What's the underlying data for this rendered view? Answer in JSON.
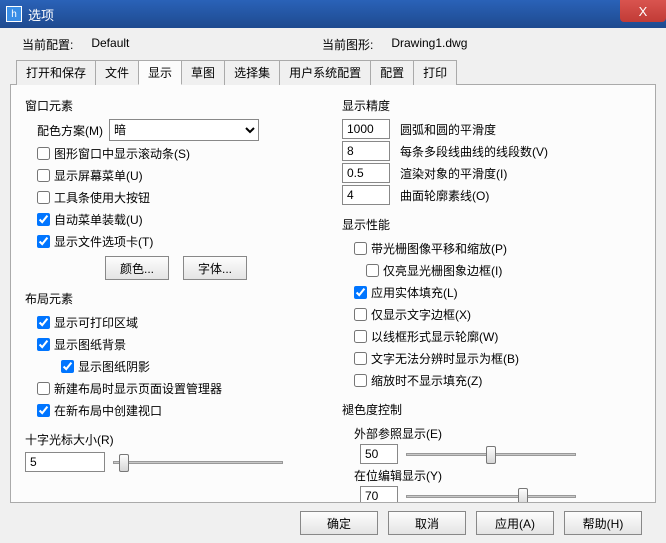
{
  "window": {
    "title": "选项",
    "close": "X"
  },
  "config": {
    "current_config_label": "当前配置:",
    "current_config_value": "Default",
    "current_drawing_label": "当前图形:",
    "current_drawing_value": "Drawing1.dwg"
  },
  "tabs": [
    "打开和保存",
    "文件",
    "显示",
    "草图",
    "选择集",
    "用户系统配置",
    "配置",
    "打印"
  ],
  "active_tab": 2,
  "left": {
    "window_elements": {
      "title": "窗口元素",
      "color_scheme_label": "配色方案(M)",
      "color_scheme_value": "暗",
      "scrollbar": {
        "label": "图形窗口中显示滚动条(S)",
        "checked": false
      },
      "screen_menu": {
        "label": "显示屏幕菜单(U)",
        "checked": false
      },
      "big_buttons": {
        "label": "工具条使用大按钮",
        "checked": false
      },
      "auto_menu": {
        "label": "自动菜单装载(U)",
        "checked": true
      },
      "file_tabs": {
        "label": "显示文件选项卡(T)",
        "checked": true
      },
      "color_btn": "颜色...",
      "font_btn": "字体..."
    },
    "layout_elements": {
      "title": "布局元素",
      "printable": {
        "label": "显示可打印区域",
        "checked": true
      },
      "paper_bg": {
        "label": "显示图纸背景",
        "checked": true
      },
      "paper_shadow": {
        "label": "显示图纸阴影",
        "checked": true
      },
      "page_setup": {
        "label": "新建布局时显示页面设置管理器",
        "checked": false
      },
      "viewport": {
        "label": "在新布局中创建视口",
        "checked": true
      }
    },
    "crosshair": {
      "title": "十字光标大小(R)",
      "value": "5",
      "percent": 4
    }
  },
  "right": {
    "precision": {
      "title": "显示精度",
      "arc": {
        "value": "1000",
        "label": "圆弧和圆的平滑度"
      },
      "polyline": {
        "value": "8",
        "label": "每条多段线曲线的线段数(V)"
      },
      "render": {
        "value": "0.5",
        "label": "渲染对象的平滑度(I)"
      },
      "surface": {
        "value": "4",
        "label": "曲面轮廓素线(O)"
      }
    },
    "performance": {
      "title": "显示性能",
      "raster": {
        "label": "带光栅图像平移和缩放(P)",
        "checked": false
      },
      "highlight": {
        "label": "仅亮显光栅图象边框(I)",
        "checked": false
      },
      "solid_fill": {
        "label": "应用实体填充(L)",
        "checked": true
      },
      "text_frame": {
        "label": "仅显示文字边框(X)",
        "checked": false
      },
      "wire_frame": {
        "label": "以线框形式显示轮廓(W)",
        "checked": false
      },
      "text_box": {
        "label": "文字无法分辨时显示为框(B)",
        "checked": false
      },
      "zoom_fill": {
        "label": "缩放时不显示填充(Z)",
        "checked": false
      }
    },
    "fade": {
      "title": "褪色度控制",
      "xref_label": "外部参照显示(E)",
      "xref_value": "50",
      "xref_percent": 50,
      "inplace_label": "在位编辑显示(Y)",
      "inplace_value": "70",
      "inplace_percent": 70
    }
  },
  "footer": {
    "ok": "确定",
    "cancel": "取消",
    "apply": "应用(A)",
    "help": "帮助(H)"
  }
}
